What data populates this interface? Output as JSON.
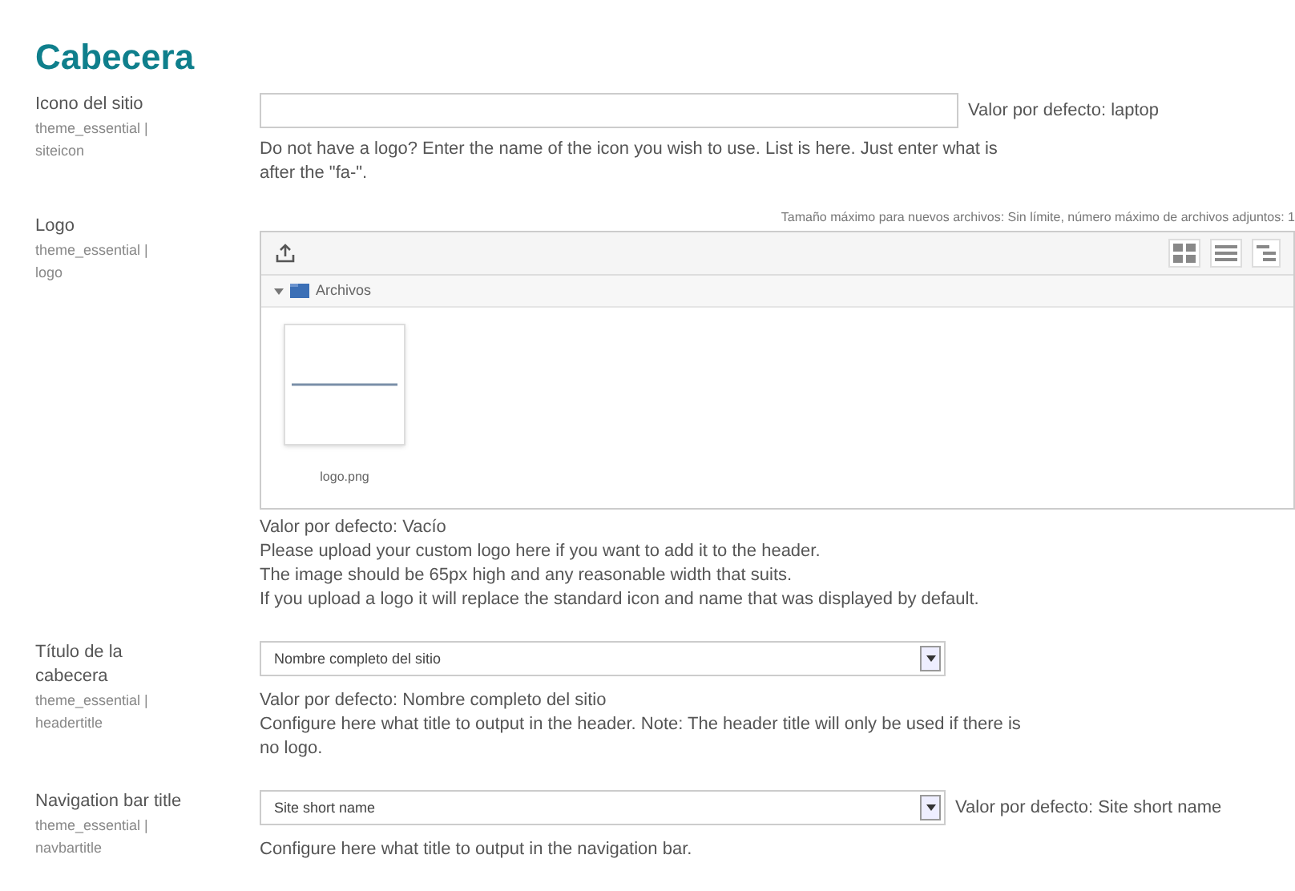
{
  "heading": "Cabecera",
  "settings": [
    {
      "kind": "text",
      "label": "Icono del sitio",
      "key": "theme_essential | siteicon",
      "default": "Valor por defecto: laptop",
      "description": [
        "Do not have a logo? Enter the name of the icon you wish to use. List is here. Just enter what is after the \"fa-\"."
      ]
    },
    {
      "kind": "filepicker",
      "label": "Logo",
      "key": "theme_essential | logo",
      "limits": "Tamaño máximo para nuevos archivos: Sin límite, número máximo de archivos adjuntos: 1",
      "folder": "Archivos",
      "files": [
        "logo.png"
      ],
      "default": "Valor por defecto: Vacío",
      "description": [
        "Please upload your custom logo here if you want to add it to the header.",
        "The image should be 65px high and any reasonable width that suits.",
        "If you upload a logo it will replace the standard icon and name that was displayed by default."
      ]
    },
    {
      "kind": "select",
      "label": "Título de la cabecera",
      "key": "theme_essential | headertitle",
      "value": "Nombre completo del sitio",
      "default": "Valor por defecto: Nombre completo del sitio",
      "default_inline": false,
      "description": [
        "Configure here what title to output in the header. Note: The header title will only be used if there is no logo."
      ]
    },
    {
      "kind": "select",
      "label": "Navigation bar title",
      "key": "theme_essential | navbartitle",
      "value": "Site short name",
      "default": "Valor por defecto: Site short name",
      "default_inline": true,
      "description": [
        "Configure here what title to output in the navigation bar."
      ]
    }
  ]
}
